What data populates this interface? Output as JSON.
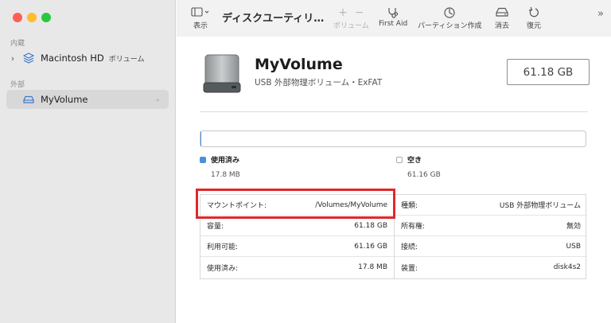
{
  "sidebar": {
    "internal_label": "内蔵",
    "external_label": "外部",
    "items": [
      {
        "label": "Macintosh HD",
        "sub": "ボリューム"
      },
      {
        "label": "MyVolume",
        "eject": "⌄"
      }
    ]
  },
  "toolbar": {
    "view_label": "表示",
    "title": "ディスクユーティリ…",
    "volume_label": "ボリューム",
    "firstaid_label": "First Aid",
    "partition_label": "パーティション作成",
    "erase_label": "消去",
    "restore_label": "復元",
    "more": "»"
  },
  "volume": {
    "name": "MyVolume",
    "subtitle": "USB 外部物理ボリューム・ExFAT",
    "size": "61.18 GB"
  },
  "usage": {
    "used_label": "使用済み",
    "used_value": "17.8 MB",
    "free_label": "空き",
    "free_value": "61.16 GB",
    "used_fraction": 0.0003,
    "used_color": "#4a90d9"
  },
  "info": {
    "left": [
      {
        "key": "マウントポイント:",
        "value": "/Volumes/MyVolume"
      },
      {
        "key": "容量:",
        "value": "61.18 GB"
      },
      {
        "key": "利用可能:",
        "value": "61.16 GB"
      },
      {
        "key": "使用済み:",
        "value": "17.8 MB"
      }
    ],
    "right": [
      {
        "key": "種類:",
        "value": "USB 外部物理ボリューム"
      },
      {
        "key": "所有権:",
        "value": "無効"
      },
      {
        "key": "接続:",
        "value": "USB"
      },
      {
        "key": "装置:",
        "value": "disk4s2"
      }
    ]
  },
  "highlight_color": "#e0282a"
}
